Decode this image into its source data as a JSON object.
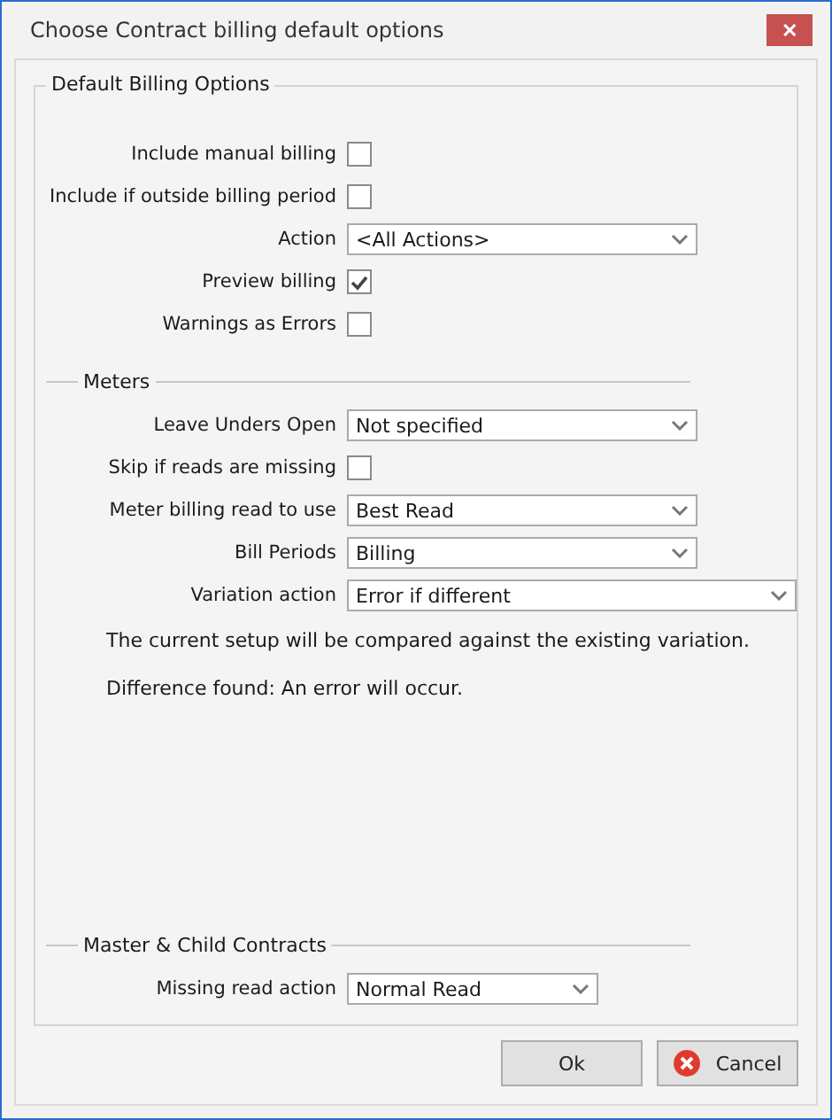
{
  "window": {
    "title": "Choose Contract billing default options",
    "close": "✕"
  },
  "group": {
    "title": "Default Billing Options",
    "rows": [
      {
        "kind": "checkbox",
        "label": "Include manual billing",
        "checked": false
      },
      {
        "kind": "checkbox",
        "label": "Include if outside billing period",
        "checked": false
      },
      {
        "kind": "select",
        "label": "Action",
        "value": "<All Actions>"
      },
      {
        "kind": "checkbox",
        "label": "Preview billing",
        "checked": true
      },
      {
        "kind": "checkbox",
        "label": "Warnings as Errors",
        "checked": false
      }
    ]
  },
  "subsections": [
    {
      "title": "Meters",
      "rows": [
        {
          "kind": "select",
          "label": "Leave Unders Open",
          "value": "Not specified"
        },
        {
          "kind": "checkbox",
          "label": "Skip if reads are missing",
          "checked": false
        },
        {
          "kind": "select",
          "label": "Meter billing read to use",
          "value": "Best Read"
        },
        {
          "kind": "select",
          "label": "Bill Periods",
          "value": "Billing"
        },
        {
          "kind": "select",
          "label": "Variation action",
          "value": "Error if different"
        },
        {
          "kind": "note",
          "text": "The current setup will be compared against the existing variation."
        },
        {
          "kind": "note",
          "text": "Difference found: An error will occur."
        }
      ]
    },
    {
      "title": "Master & Child Contracts",
      "rows": [
        {
          "kind": "select",
          "label": "Missing read action",
          "value": "Normal Read"
        }
      ]
    }
  ],
  "buttons": [
    {
      "kind": "ok",
      "label": "Ok"
    },
    {
      "kind": "cancel",
      "label": "Cancel"
    }
  ]
}
